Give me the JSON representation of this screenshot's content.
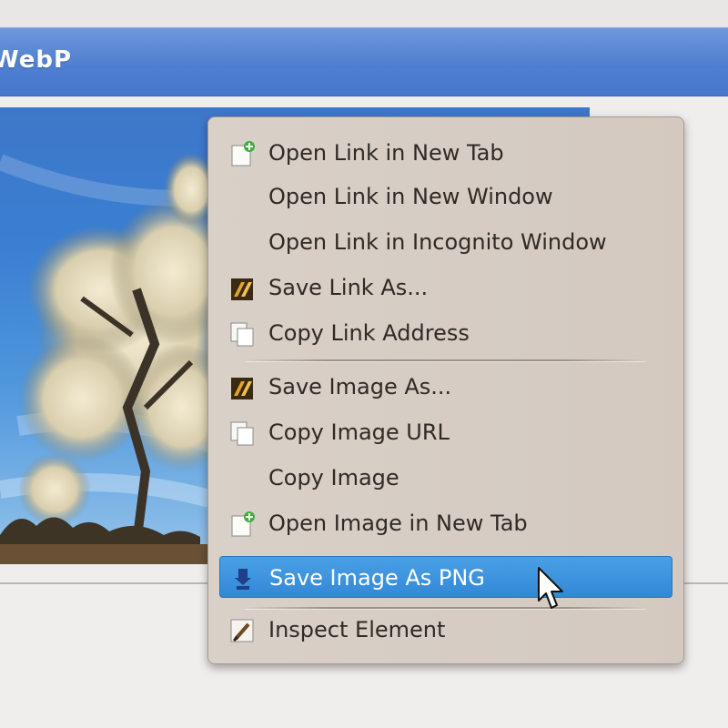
{
  "window": {
    "title": "WebP"
  },
  "menu": {
    "items": [
      {
        "label": "Open Link in New Tab",
        "icon": "new-tab-icon"
      },
      {
        "label": "Open Link in New Window",
        "icon": ""
      },
      {
        "label": "Open Link in Incognito Window",
        "icon": ""
      },
      {
        "label": "Save Link As...",
        "icon": "save-as-icon"
      },
      {
        "label": "Copy Link Address",
        "icon": "copy-icon"
      },
      {
        "label": "Save Image As...",
        "icon": "save-as-icon"
      },
      {
        "label": "Copy Image URL",
        "icon": "copy-icon"
      },
      {
        "label": "Copy Image",
        "icon": ""
      },
      {
        "label": "Open Image in New Tab",
        "icon": "new-tab-icon"
      },
      {
        "label": "Save Image As PNG",
        "icon": "png-save-icon",
        "highlighted": true
      },
      {
        "label": "Inspect Element",
        "icon": "inspect-icon"
      }
    ]
  },
  "colors": {
    "title_bar": "#4f7fd0",
    "menu_background": "#d6ccc3",
    "highlight": "#3a8edb",
    "text": "#2f2a27"
  }
}
